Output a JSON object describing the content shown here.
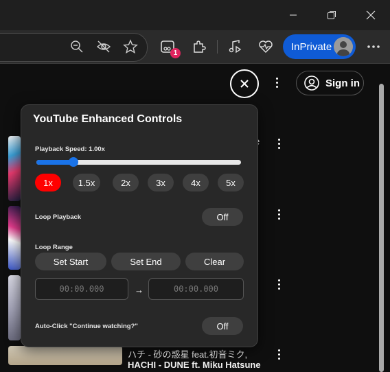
{
  "window": {
    "minimize_icon": "minimize-icon",
    "restore_icon": "restore-icon",
    "close_icon": "close-icon"
  },
  "toolbar": {
    "inprivate_label": "InPrivate",
    "extension_badge": "1"
  },
  "youtube": {
    "sign_in_label": "Sign in",
    "partial_title_char": "e",
    "video_title_line1": "ハチ - 砂の惑星 feat.初音ミク,",
    "video_title_line2": "HACHI - DUNE ft. Miku Hatsune"
  },
  "panel": {
    "title": "YouTube Enhanced Controls",
    "speed_label": "Playback Speed: 1.00x",
    "speed_value_fraction": 0.18,
    "speeds": [
      "1x",
      "1.5x",
      "2x",
      "3x",
      "4x",
      "5x"
    ],
    "active_speed": "1x",
    "loop_playback_label": "Loop Playback",
    "loop_playback_state": "Off",
    "loop_range_label": "Loop Range",
    "set_start_label": "Set Start",
    "set_end_label": "Set End",
    "clear_label": "Clear",
    "start_time_placeholder": "00:00.000",
    "end_time_placeholder": "00:00.000",
    "arrow": "→",
    "auto_click_label": "Auto-Click \"Continue watching?\"",
    "auto_click_state": "Off"
  },
  "colors": {
    "accent": "#1a73e8",
    "active_speed": "#ff0000",
    "inprivate": "#0f5bd6"
  }
}
